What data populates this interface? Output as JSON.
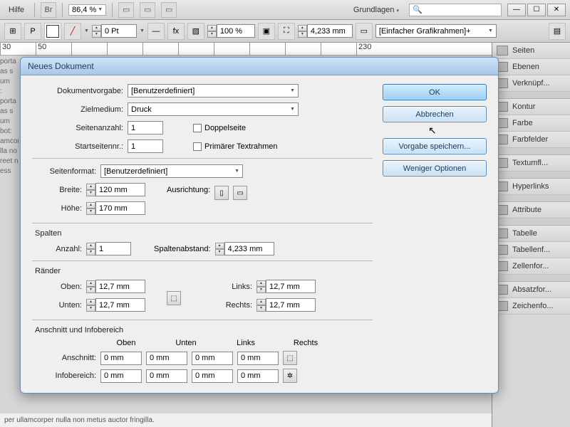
{
  "top": {
    "help": "Hilfe",
    "zoom": "86,4 %",
    "workspace": "Grundlagen",
    "search_placeholder": "🔍"
  },
  "toolbar2": {
    "stroke": "0 Pt",
    "opacity": "100 %",
    "measure": "4,233 mm",
    "frame_preset": "[Einfacher Grafikrahmen]+"
  },
  "ruler": [
    "30",
    "50",
    "",
    "",
    "",
    "",
    "",
    "",
    "",
    "",
    "230"
  ],
  "panels": [
    "Seiten",
    "Ebenen",
    "Verknüpf...",
    "Kontur",
    "Farbe",
    "Farbfelder",
    "Textumfl...",
    "Hyperlinks",
    "Attribute",
    "Tabelle",
    "Tabellenf...",
    "Zellenfor...",
    "Absatzfor...",
    "Zeichenfo..."
  ],
  "dialog": {
    "title": "Neues Dokument",
    "labels": {
      "preset": "Dokumentvorgabe:",
      "intent": "Zielmedium:",
      "pages": "Seitenanzahl:",
      "start": "Startseitennr.:",
      "facing": "Doppelseite",
      "primary": "Primärer Textrahmen",
      "page_size": "Seitenformat:",
      "width": "Breite:",
      "height": "Höhe:",
      "orientation": "Ausrichtung:",
      "columns": "Spalten",
      "col_count": "Anzahl:",
      "gutter": "Spaltenabstand:",
      "margins": "Ränder",
      "top": "Oben:",
      "bottom": "Unten:",
      "left": "Links:",
      "right": "Rechts:",
      "bleed_section": "Anschnitt und Infobereich",
      "bleed": "Anschnitt:",
      "slug": "Infobereich:",
      "col_top": "Oben",
      "col_bottom": "Unten",
      "col_left": "Links",
      "col_right": "Rechts"
    },
    "values": {
      "preset": "[Benutzerdefiniert]",
      "intent": "Druck",
      "pages": "1",
      "start": "1",
      "page_size": "[Benutzerdefiniert]",
      "width": "120 mm",
      "height": "170 mm",
      "col_count": "1",
      "gutter": "4,233 mm",
      "m_top": "12,7 mm",
      "m_bottom": "12,7 mm",
      "m_left": "12,7 mm",
      "m_right": "12,7 mm",
      "b_top": "0 mm",
      "b_bottom": "0 mm",
      "b_left": "0 mm",
      "b_right": "0 mm",
      "s_top": "0 mm",
      "s_bottom": "0 mm",
      "s_left": "0 mm",
      "s_right": "0 mm"
    },
    "buttons": {
      "ok": "OK",
      "cancel": "Abbrechen",
      "save_preset": "Vorgabe speichern...",
      "fewer": "Weniger Optionen"
    }
  },
  "doc_placeholder": "porta\nas s\num\n:\nporta\nas s\num\nbot:\namcor\nlla no\nreet n\ness",
  "footer": "per ullamcorper nulla non metus auctor fringilla."
}
